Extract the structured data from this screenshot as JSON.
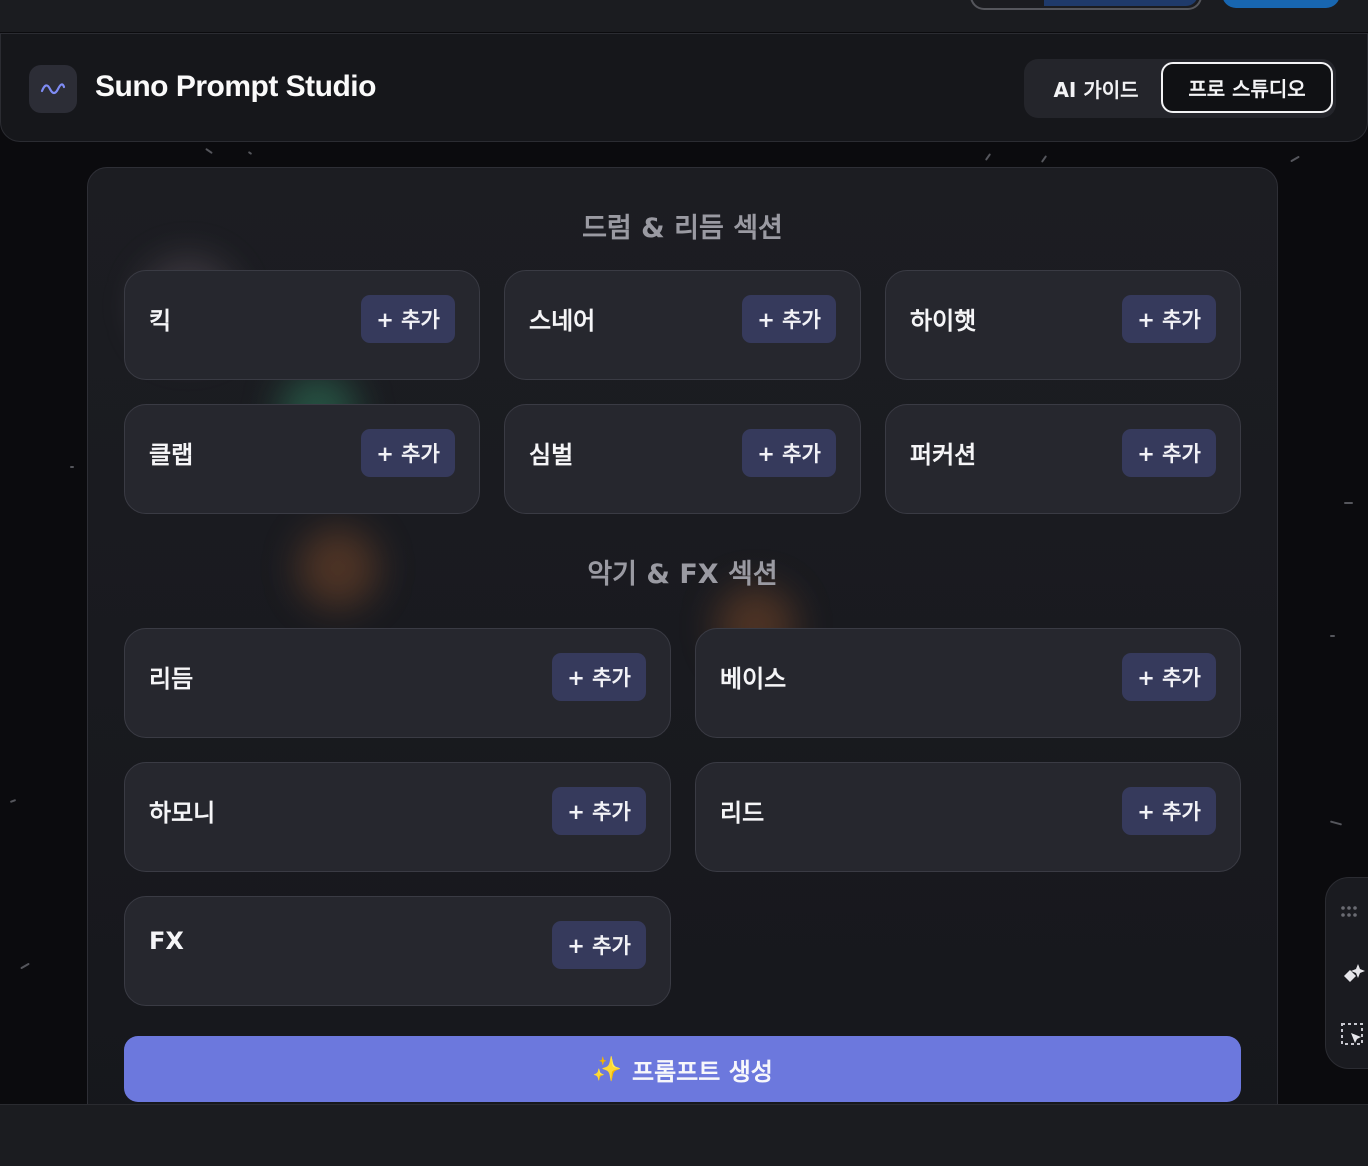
{
  "header": {
    "title": "Suno Prompt Studio",
    "mode_ai": "AI 가이드",
    "mode_pro": "프로 스튜디오"
  },
  "sections": [
    {
      "title": "드럼 & 리듬 섹션",
      "items": [
        "킥",
        "스네어",
        "하이햇",
        "클랩",
        "심벌",
        "퍼커션"
      ]
    },
    {
      "title": "악기 & FX 섹션",
      "items": [
        "리듬",
        "베이스",
        "하모니",
        "리드",
        "FX"
      ]
    }
  ],
  "add_label": "+ 추가",
  "generate": {
    "icon": "✨",
    "label": "프롬프트 생성"
  },
  "icons": {
    "logo": "waveform-icon",
    "side_tools": [
      "grip-icon",
      "magic-wand-icon",
      "selection-icon"
    ]
  },
  "colors": {
    "accent": "#6c78dd",
    "add_button": "#363a5c",
    "card": "#26272e",
    "background": "#0b0b0e"
  }
}
